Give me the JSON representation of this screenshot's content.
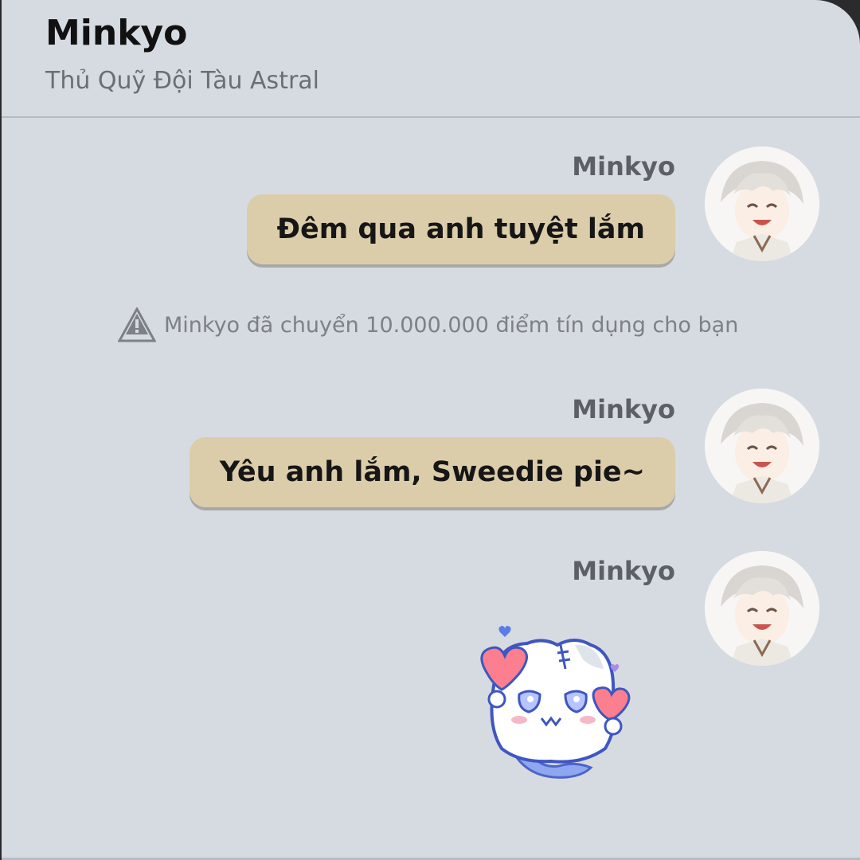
{
  "header": {
    "title": "Minkyo",
    "subtitle": "Thủ Quỹ Đội Tàu Astral"
  },
  "messages": [
    {
      "sender": "Minkyo",
      "text": "Đêm qua anh tuyệt lắm"
    },
    {
      "sender": "Minkyo",
      "text": "Yêu anh lắm, Sweedie pie~"
    },
    {
      "sender": "Minkyo",
      "sticker": "heart-ghost-sticker"
    }
  ],
  "system_notice": {
    "icon": "warning-triangle-icon",
    "text": "Minkyo đã chuyển 10.000.000 điểm tín dụng cho bạn"
  },
  "colors": {
    "panel_bg": "#d6dbe1",
    "bubble_bg": "#dccdaa",
    "title": "#111111",
    "muted": "#6b6f75"
  }
}
